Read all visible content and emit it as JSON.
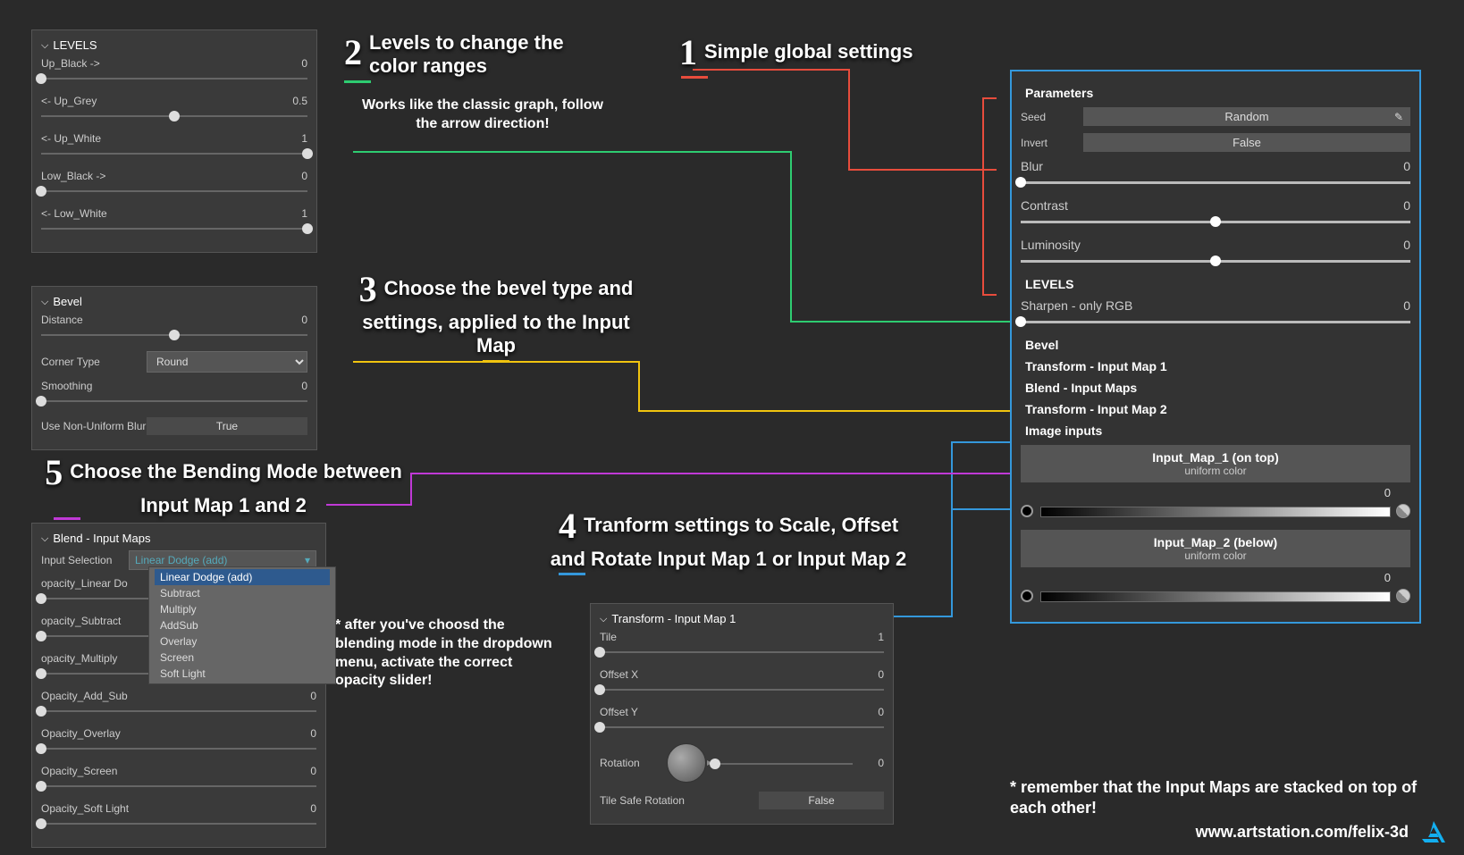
{
  "levels": {
    "title": "LEVELS",
    "rows": [
      {
        "label": "Up_Black ->",
        "value": "0",
        "pos": 0
      },
      {
        "label": "<- Up_Grey",
        "value": "0.5",
        "pos": 50
      },
      {
        "label": "<- Up_White",
        "value": "1",
        "pos": 100
      },
      {
        "label": "Low_Black ->",
        "value": "0",
        "pos": 0
      },
      {
        "label": "<- Low_White",
        "value": "1",
        "pos": 100
      }
    ]
  },
  "bevel": {
    "title": "Bevel",
    "distance": {
      "label": "Distance",
      "value": "0",
      "pos": 50
    },
    "corner": {
      "label": "Corner Type",
      "value": "Round"
    },
    "smoothing": {
      "label": "Smoothing",
      "value": "0",
      "pos": 0
    },
    "nub": {
      "label": "Use Non-Uniform Blur",
      "value": "True"
    }
  },
  "blend": {
    "title": "Blend -  Input Maps",
    "inputSel": {
      "label": "Input Selection",
      "value": "Linear Dodge (add)"
    },
    "options": [
      "Linear Dodge (add)",
      "Subtract",
      "Multiply",
      "AddSub",
      "Overlay",
      "Screen",
      "Soft Light"
    ],
    "sliders": [
      {
        "label": "opacity_Linear Do",
        "value": "",
        "pos": 0
      },
      {
        "label": "opacity_Subtract",
        "value": "0",
        "pos": 0
      },
      {
        "label": "opacity_Multiply",
        "value": "",
        "pos": 0
      },
      {
        "label": "Opacity_Add_Sub",
        "value": "0",
        "pos": 0
      },
      {
        "label": "Opacity_Overlay",
        "value": "0",
        "pos": 0
      },
      {
        "label": "Opacity_Screen",
        "value": "0",
        "pos": 0
      },
      {
        "label": "Opacity_Soft Light",
        "value": "0",
        "pos": 0
      }
    ]
  },
  "transform": {
    "title": "Transform - Input Map 1",
    "tile": {
      "label": "Tile",
      "value": "1",
      "pos": 0
    },
    "offx": {
      "label": "Offset X",
      "value": "0",
      "pos": 0
    },
    "offy": {
      "label": "Offset Y",
      "value": "0",
      "pos": 0
    },
    "rot": {
      "label": "Rotation",
      "value": "0",
      "pos": 0
    },
    "tsr": {
      "label": "Tile Safe Rotation",
      "value": "False"
    }
  },
  "params": {
    "title": "Parameters",
    "seed": {
      "label": "Seed",
      "value": "Random"
    },
    "invert": {
      "label": "Invert",
      "value": "False"
    },
    "blur": {
      "label": "Blur",
      "value": "0",
      "pos": 0
    },
    "contrast": {
      "label": "Contrast",
      "value": "0",
      "pos": 50
    },
    "lum": {
      "label": "Luminosity",
      "value": "0",
      "pos": 50
    },
    "levels": "LEVELS",
    "sharpen": {
      "label": "Sharpen - only RGB",
      "value": "0",
      "pos": 0
    },
    "bevel": "Bevel",
    "t1": "Transform - Input Map 1",
    "blend": "Blend -  Input Maps",
    "t2": "Transform - Input Map 2",
    "imgInputs": "Image inputs",
    "im1": {
      "title": "Input_Map_1 (on top)",
      "sub": "uniform color",
      "value": "0"
    },
    "im2": {
      "title": "Input_Map_2 (below)",
      "sub": "uniform color",
      "value": "0"
    }
  },
  "ann": {
    "a1": {
      "t": "Simple global settings"
    },
    "a2": {
      "t": "Levels to change the color ranges",
      "sub": "Works like the classic graph, follow the arrow direction!"
    },
    "a3": {
      "t": "Choose the bevel type and settings, applied to the Input Map"
    },
    "a4": {
      "t": "Tranform settings to Scale, Offset and Rotate Input Map 1 or Input Map 2"
    },
    "a5": {
      "t": "Choose the Bending Mode between Input Map 1 and 2",
      "sub": "* after you've choosd the blending mode in the dropdown menu, activate the correct opacity slider!"
    },
    "note": "* remember that the Input Maps are stacked on top of each other!",
    "url": "www.artstation.com/felix-3d"
  }
}
